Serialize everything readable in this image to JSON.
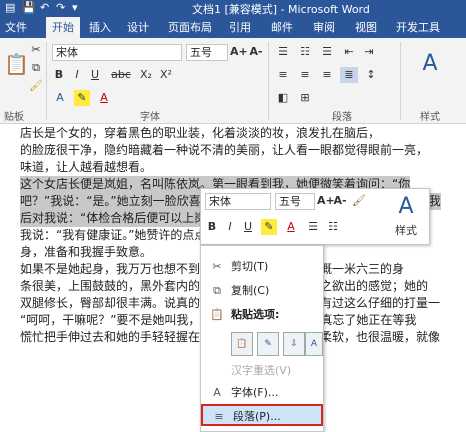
{
  "titlebar": {
    "title": "文档1 [兼容模式] - Microsoft Word",
    "icons": [
      "word-icon",
      "save-icon",
      "undo-icon",
      "redo-icon",
      "customize-icon"
    ]
  },
  "tabs": [
    "文件",
    "开始",
    "插入",
    "设计",
    "页面布局",
    "引用",
    "邮件",
    "审阅",
    "视图",
    "开发工具"
  ],
  "ribbon": {
    "clipboard": {
      "label": "贴板",
      "paste_icon": "paste-icon"
    },
    "font": {
      "name": "宋体",
      "size": "五号",
      "label": "字体",
      "buttons": [
        "A+",
        "A-",
        "Aa",
        "A"
      ],
      "format": [
        "B",
        "I",
        "U",
        "abc",
        "X₂",
        "X²"
      ]
    },
    "paragraph": {
      "label": "段落"
    },
    "styles": {
      "label": "样式"
    }
  },
  "doc": {
    "lines": [
      "店长是个女的，穿着黑色的职业装，化着淡淡的妆，浪发扎在脑后，",
      "的脸庞很干净，隐约暗藏着一种说不清的美丽，让人看一眼都觉得眼前一亮，",
      "味道，让人越看越想看。",
      "    这个女店长便是岚姐，名叫陈依岚。第一眼看到我，她便微笑着询问：“你",
      "吧？”我说：“是。”她立刻一脸欣喜，让我先在店里跟着一起工作。随后她就让我",
      "后对我说：“体检合格后便可以上岗，你是个好员工。”",
      "    我说：“我有健康证。”她赞许的点点头，笑着说：“你随时可以上班。”说",
      "身，准备和我握手致意。",
      "    如果不是她起身，我万万也想不到她的身材会这么好。大概一米六三的身",
      "条很美，上围鼓鼓的，黑外套内的衬衣扣子好像都有种呼之欲出的感觉；她的",
      "双腿修长，臀部却很丰满。说真的，从来没有对一个女人有过这么仔细的打量一",
      "    “呵呵，干嘛呢？”要不是她叫我，我都没反应过来。我还真忘了她正在等我",
      "慌忙把手伸过去和她的手轻轻握在一起。她的手很嫩，很柔软，也很温暖，就像"
    ]
  },
  "mini_toolbar": {
    "font": "宋体",
    "size": "五号",
    "items": [
      "A+",
      "A-",
      "Aa",
      "B",
      "I",
      "U",
      "A",
      "styles-label"
    ],
    "styles_label": "样式"
  },
  "context_menu": {
    "items": [
      {
        "icon": "cut-icon",
        "label": "剪切(T)"
      },
      {
        "icon": "copy-icon",
        "label": "复制(C)"
      },
      {
        "icon": "paste-options-icon",
        "label": "粘贴选项:"
      },
      {
        "icon": "",
        "label": "汉字重选(V)"
      },
      {
        "icon": "font-icon",
        "label": "字体(F)..."
      },
      {
        "icon": "paragraph-icon",
        "label": "段落(P)..."
      }
    ]
  }
}
